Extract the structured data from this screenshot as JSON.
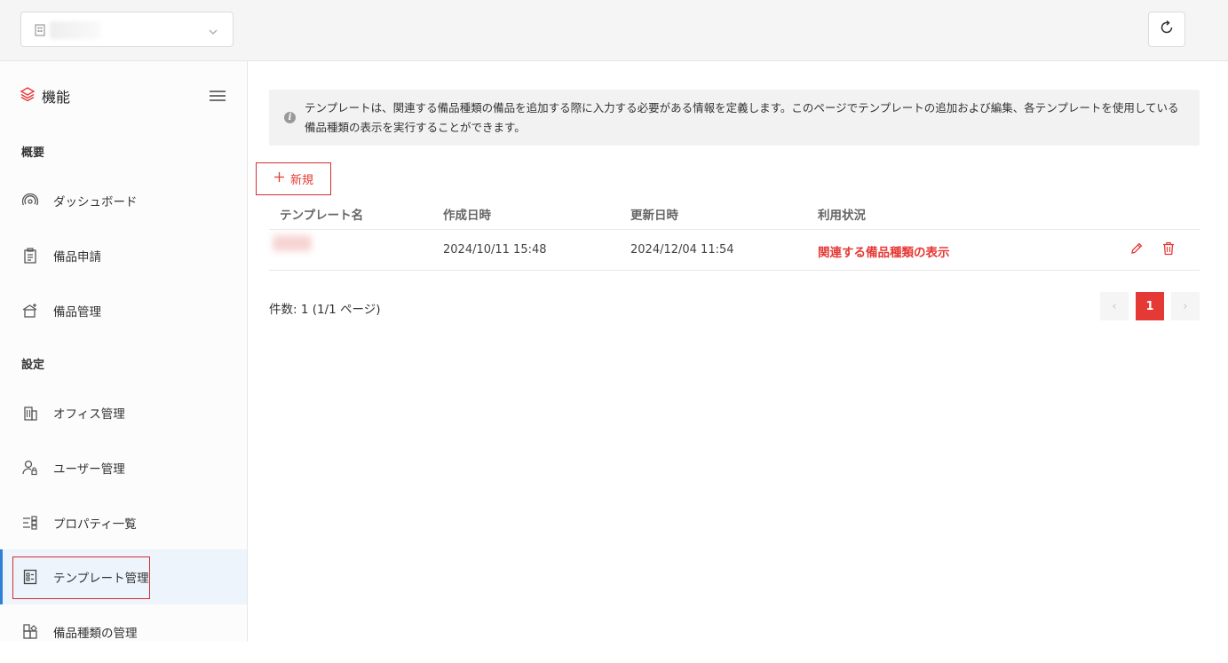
{
  "topbar": {
    "office_select_icon": "building-icon",
    "refresh_icon": "refresh-icon"
  },
  "sidebar": {
    "header": "機能",
    "sections": [
      {
        "title": "概要"
      },
      {
        "title": "設定"
      }
    ],
    "items": [
      {
        "label": "ダッシュボード",
        "icon": "dashboard-icon"
      },
      {
        "label": "備品申請",
        "icon": "clipboard-icon"
      },
      {
        "label": "備品管理",
        "icon": "equipment-icon"
      },
      {
        "label": "オフィス管理",
        "icon": "office-icon"
      },
      {
        "label": "ユーザー管理",
        "icon": "user-lock-icon"
      },
      {
        "label": "プロパティ一覧",
        "icon": "property-list-icon"
      },
      {
        "label": "テンプレート管理",
        "icon": "template-icon"
      },
      {
        "label": "備品種類の管理",
        "icon": "category-icon"
      }
    ],
    "active_item": "テンプレート管理"
  },
  "main": {
    "info_text": "テンプレートは、関連する備品種類の備品を追加する際に入力する必要がある情報を定義します。このページでテンプレートの追加および編集、各テンプレートを使用している備品種類の表示を実行することができます。",
    "new_button": "新規",
    "table": {
      "headers": [
        "テンプレート名",
        "作成日時",
        "更新日時",
        "利用状況"
      ],
      "rows": [
        {
          "name": "",
          "created": "2024/10/11 15:48",
          "updated": "2024/12/04 11:54",
          "usage": "関連する備品種類の表示"
        }
      ]
    },
    "count_text": "件数: 1 (1/1 ページ)",
    "pagination": {
      "prev": "‹",
      "current": "1",
      "next": "›"
    }
  },
  "colors": {
    "accent": "#e53935",
    "active_bg": "#edf4fc",
    "active_bar": "#2f7fd6"
  }
}
